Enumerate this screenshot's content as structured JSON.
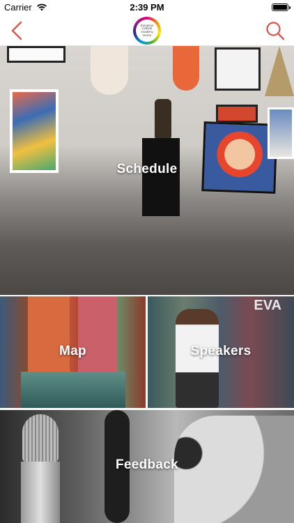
{
  "status_bar": {
    "carrier": "Carrier",
    "time": "2:39 PM"
  },
  "nav": {
    "logo_lines": [
      "European",
      "Cultural",
      "Academy",
      "Venice"
    ],
    "accent_color": "#d9534f"
  },
  "tiles": {
    "schedule": "Schedule",
    "map": "Map",
    "speakers": "Speakers",
    "feedback": "Feedback"
  },
  "overlays": {
    "speakers_graffiti": "EVA"
  }
}
